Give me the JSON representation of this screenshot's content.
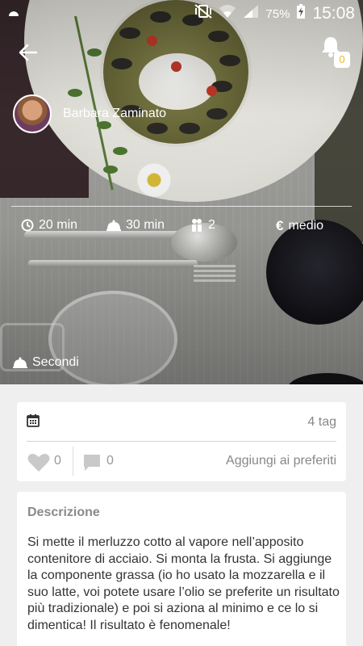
{
  "status_bar": {
    "left_glyph": "cloud-icon",
    "battery_percent": "75%",
    "time": "15:08",
    "icons": [
      "vibrate-icon",
      "wifi-icon",
      "signal-icon",
      "battery-charging-icon"
    ]
  },
  "top": {
    "back_icon": "arrow-left-icon",
    "notification_icon": "bell-icon",
    "notification_count": "0"
  },
  "author": {
    "name": "Barbara Zaminato"
  },
  "recipe_meta": {
    "prep_time": "20 min",
    "cook_time": "30 min",
    "servings": "2",
    "cost": "medio",
    "cost_symbol": "€",
    "category": "Secondi"
  },
  "actions": {
    "tag_count": "4 tag",
    "likes": "0",
    "comments": "0",
    "favorite_label": "Aggiungi ai preferiti"
  },
  "description": {
    "title": "Descrizione",
    "text": "Si mette il merluzzo cotto al vapore nell’apposito contenitore di acciaio. Si monta la frusta. Si aggiunge la componente grassa (io ho usato la mozzarella e il suo latte, voi potete usare l’olio se preferite un risultato più tradizionale) e poi si aziona al minimo e ce lo si dimentica! Il risultato è fenomenale!"
  },
  "colors": {
    "accent": "#e8b732",
    "page_bg": "#efefef",
    "card_bg": "#ffffff",
    "muted_text": "#888888"
  }
}
